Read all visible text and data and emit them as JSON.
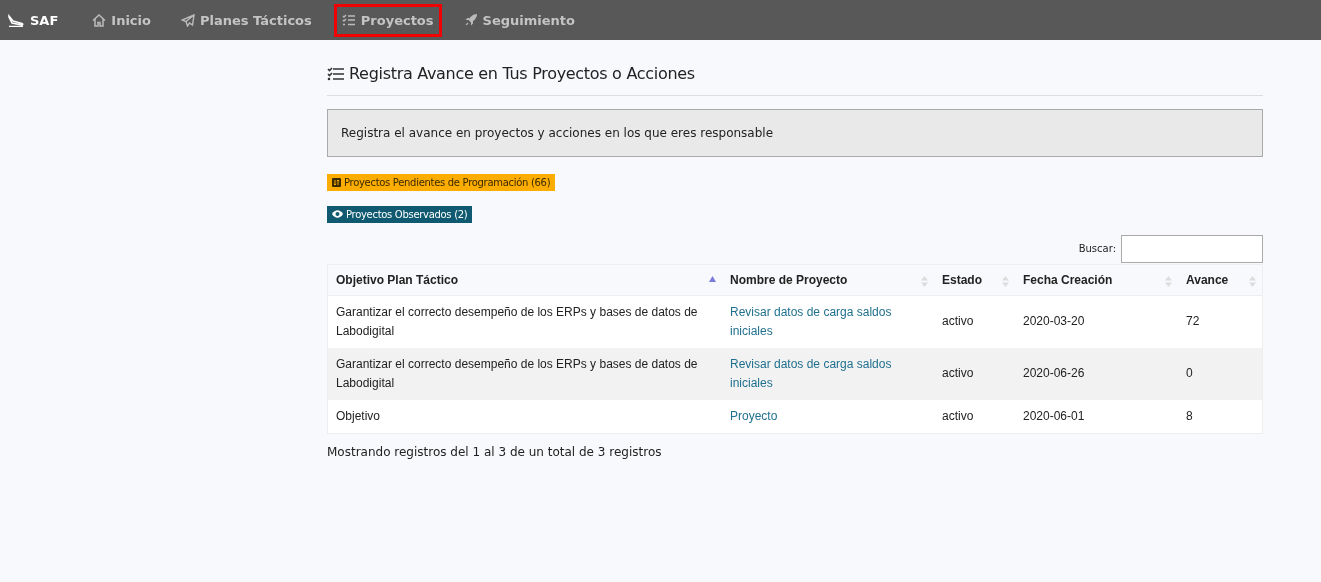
{
  "navbar": {
    "brand": "SAF",
    "items": [
      {
        "label": "Inicio",
        "kind": "home",
        "highlighted": false
      },
      {
        "label": "Planes Tácticos",
        "kind": "plane",
        "highlighted": false
      },
      {
        "label": "Proyectos",
        "kind": "list",
        "highlighted": true
      },
      {
        "label": "Seguimiento",
        "kind": "rocket",
        "highlighted": false
      }
    ]
  },
  "page": {
    "title": "Registra Avance en Tus Proyectos o Acciones",
    "notice": "Registra el avance en proyectos y acciones en los que eres responsable",
    "buttons": [
      {
        "label": "Proyectos Pendientes de Programación (66)",
        "kind": "pending"
      },
      {
        "label": "Proyectos Observados (2)",
        "kind": "observed"
      }
    ],
    "search": {
      "label": "Buscar:"
    },
    "table": {
      "columns": [
        {
          "label": "Objetivo Plan Táctico",
          "sorted": true
        },
        {
          "label": "Nombre de Proyecto",
          "sorted": false
        },
        {
          "label": "Estado",
          "sorted": false
        },
        {
          "label": "Fecha Creación",
          "sorted": false
        },
        {
          "label": "Avance",
          "sorted": false
        }
      ],
      "rows": [
        [
          "Garantizar el correcto desempeño de los ERPs y bases de datos de Labodigital",
          "Revisar datos de carga saldos iniciales",
          "activo",
          "2020-03-20",
          "72"
        ],
        [
          "Garantizar el correcto desempeño de los ERPs y bases de datos de Labodigital",
          "Revisar datos de carga saldos iniciales",
          "activo",
          "2020-06-26",
          "0"
        ],
        [
          "Objetivo",
          "Proyecto",
          "activo",
          "2020-06-01",
          "8"
        ]
      ]
    },
    "info": "Mostrando registros del 1 al 3 de un total de 3 registros"
  }
}
